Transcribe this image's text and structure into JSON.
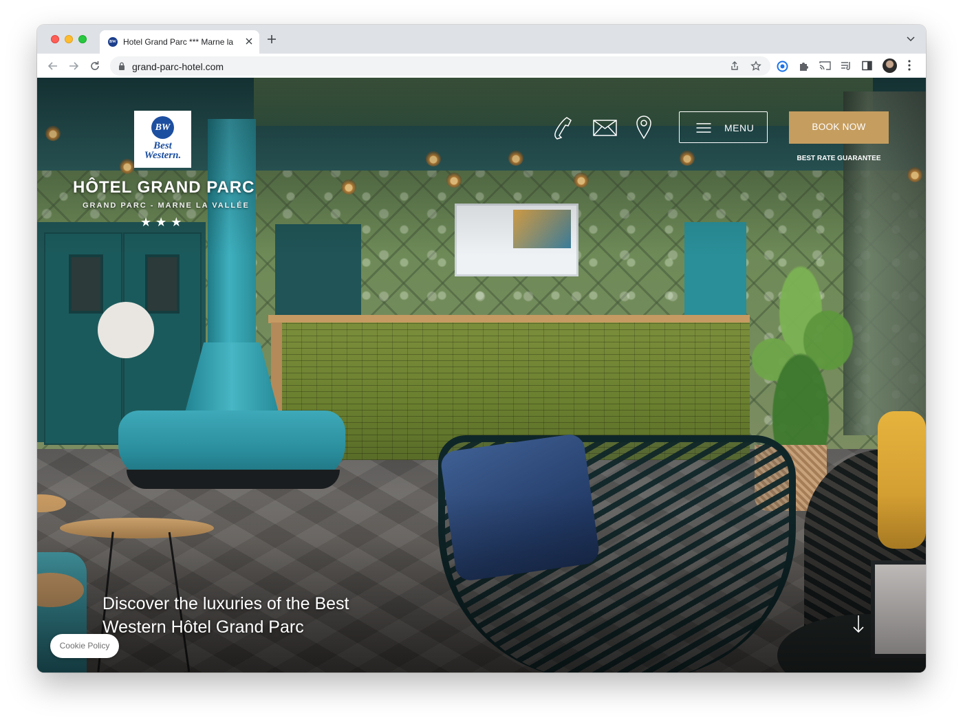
{
  "browser": {
    "tab_title": "Hotel Grand Parc *** Marne la",
    "tab_favicon_text": "BW",
    "url": "grand-parc-hotel.com",
    "icons": [
      "back-icon",
      "forward-icon",
      "reload-icon",
      "lock-icon",
      "share-icon",
      "bookmark-star-icon",
      "extension-icon",
      "puzzle-icon",
      "cast-icon",
      "reading-list-icon",
      "side-panel-icon",
      "profile-avatar",
      "more-menu-icon",
      "tab-list-icon",
      "new-tab-icon",
      "close-icon"
    ]
  },
  "site": {
    "logo": {
      "monogram": "BW",
      "line1": "Best",
      "line2": "Western."
    },
    "hotel_name": "HÔTEL GRAND PARC",
    "subtitle": "GRAND PARC - MARNE LA VALLÉE",
    "stars": "★★★",
    "header_icons": [
      "phone-icon",
      "mail-icon",
      "map-pin-icon"
    ],
    "menu_label": "MENU",
    "book_label": "BOOK NOW",
    "best_rate": "BEST RATE GUARANTEE",
    "headline": "Discover the luxuries of the Best Western Hôtel Grand Parc",
    "cookie_label": "Cookie Policy",
    "colors": {
      "book_button": "#c59d5f",
      "logo_blue": "#1d4fa0"
    }
  }
}
